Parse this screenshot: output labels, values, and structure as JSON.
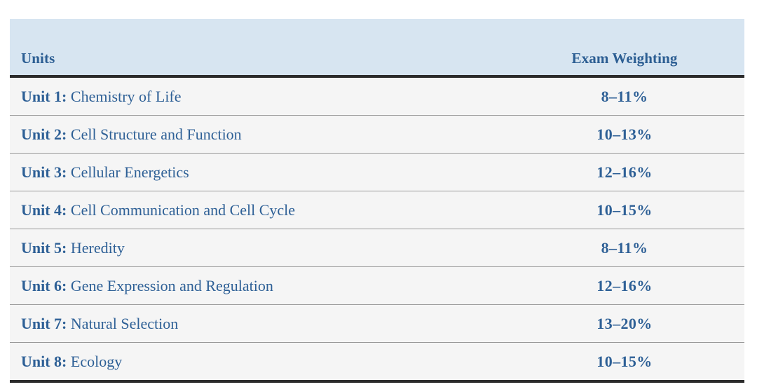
{
  "table": {
    "columns": {
      "units_header": "Units",
      "weighting_header": "Exam Weighting"
    },
    "rows": [
      {
        "unit_label": "Unit 1:",
        "unit_title": "Chemistry of Life",
        "weighting": "8–11%"
      },
      {
        "unit_label": "Unit 2:",
        "unit_title": "Cell Structure and Function",
        "weighting": "10–13%"
      },
      {
        "unit_label": "Unit 3:",
        "unit_title": "Cellular Energetics",
        "weighting": "12–16%"
      },
      {
        "unit_label": "Unit 4:",
        "unit_title": "Cell Communication and Cell Cycle",
        "weighting": "10–15%"
      },
      {
        "unit_label": "Unit 5:",
        "unit_title": "Heredity",
        "weighting": "8–11%"
      },
      {
        "unit_label": "Unit 6:",
        "unit_title": "Gene Expression and Regulation",
        "weighting": "12–16%"
      },
      {
        "unit_label": "Unit 7:",
        "unit_title": "Natural Selection",
        "weighting": "13–20%"
      },
      {
        "unit_label": "Unit 8:",
        "unit_title": "Ecology",
        "weighting": "10–15%"
      }
    ]
  },
  "colors": {
    "header_background": "#d7e5f1",
    "header_text": "#2c5e93",
    "body_text": "#2e6096",
    "row_background": "#f5f5f5",
    "row_separator": "#9a9a9a",
    "rule_dark": "#2b2b2b"
  }
}
